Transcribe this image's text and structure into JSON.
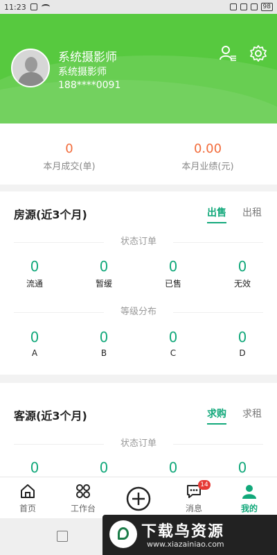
{
  "status_bar": {
    "time": "11:23",
    "battery": "98"
  },
  "header": {
    "name": "系统摄影师",
    "nickname": "系统摄影师",
    "phone": "188****0091",
    "bg_color": "#57c93f"
  },
  "stats": [
    {
      "value": "0",
      "label": "本月成交(单)"
    },
    {
      "value": "0.00",
      "label": "本月业绩(元)"
    }
  ],
  "housing": {
    "title": "房源(近3个月)",
    "tab_active": "出售",
    "tab_other": "出租",
    "status_section": "状态订单",
    "status_items": [
      {
        "value": "0",
        "label": "流通"
      },
      {
        "value": "0",
        "label": "暂缓"
      },
      {
        "value": "0",
        "label": "已售"
      },
      {
        "value": "0",
        "label": "无效"
      }
    ],
    "grade_section": "等级分布",
    "grade_items": [
      {
        "value": "0",
        "label": "A"
      },
      {
        "value": "0",
        "label": "B"
      },
      {
        "value": "0",
        "label": "C"
      },
      {
        "value": "0",
        "label": "D"
      }
    ]
  },
  "customers": {
    "title": "客源(近3个月)",
    "tab_active": "求购",
    "tab_other": "求租",
    "status_section": "状态订单",
    "status_items": [
      {
        "value": "0"
      },
      {
        "value": "0"
      },
      {
        "value": "0"
      },
      {
        "value": "0"
      }
    ]
  },
  "bottom_nav": {
    "home": "首页",
    "workbench": "工作台",
    "messages": "消息",
    "messages_badge": "14",
    "mine": "我的",
    "accent": "#11a87a"
  },
  "watermark": {
    "title": "下载鸟资源",
    "url": "www.xiazainiao.com"
  }
}
